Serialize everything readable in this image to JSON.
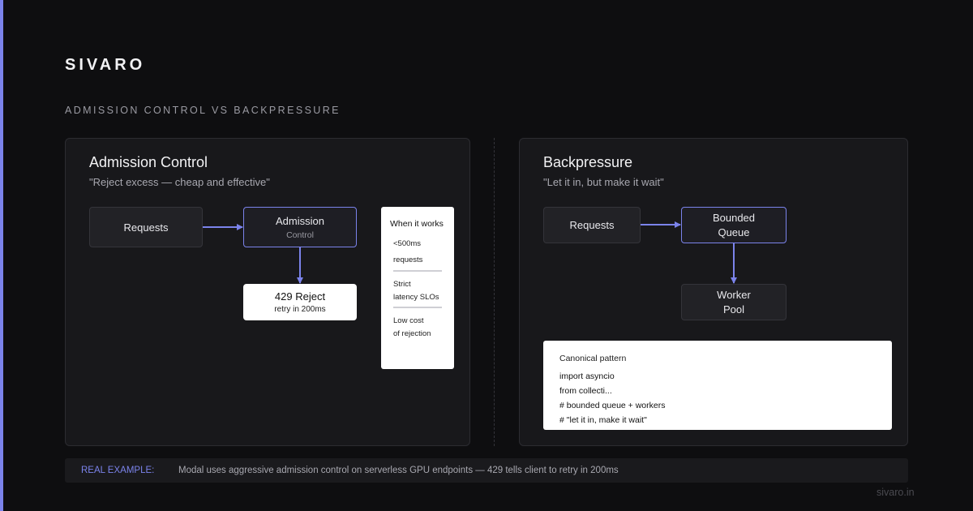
{
  "brand": "SIVARO",
  "subtitle": "ADMISSION CONTROL VS BACKPRESSURE",
  "left_panel": {
    "title": "Admission Control",
    "quote": "\"Reject excess — cheap and effective\"",
    "requests_label": "Requests",
    "admission_label": "Admission",
    "admission_sub": "Control",
    "reject_label": "429 Reject",
    "reject_sub": "retry in 200ms",
    "works": {
      "title": "When it works",
      "items": [
        [
          "<500ms",
          "requests"
        ],
        [
          "Strict",
          "latency SLOs"
        ],
        [
          "Low cost",
          "of rejection"
        ]
      ]
    }
  },
  "right_panel": {
    "title": "Backpressure",
    "quote": "\"Let it in, but make it wait\"",
    "requests_label": "Requests",
    "queue_label": [
      "Bounded",
      "Queue"
    ],
    "pool_label": [
      "Worker",
      "Pool"
    ],
    "code": {
      "title": "Canonical pattern",
      "lines": [
        "import asyncio",
        "from collecti...",
        "# bounded queue + workers",
        "# \"let it in, make it wait\""
      ]
    }
  },
  "example": {
    "label": "REAL EXAMPLE:",
    "text": "Modal uses aggressive admission control on serverless GPU endpoints — 429 tells client to retry in 200ms"
  },
  "footer_url": "sivaro.in",
  "colors": {
    "accent": "#7b83eb",
    "background": "#0e0e10",
    "panel": "#18181b"
  }
}
